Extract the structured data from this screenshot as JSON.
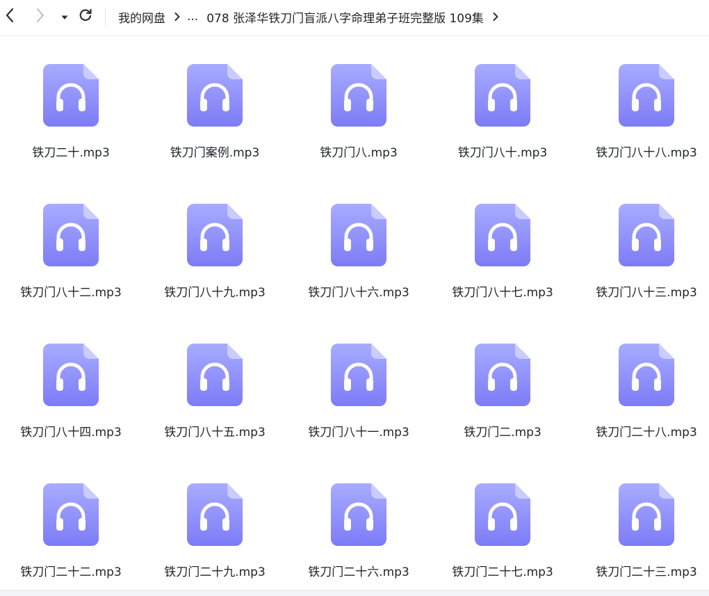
{
  "toolbar": {
    "back_icon": "chevron-left-icon",
    "forward_icon": "chevron-right-icon",
    "history_icon": "caret-down-icon",
    "refresh_icon": "refresh-icon"
  },
  "breadcrumb": {
    "root": "我的网盘",
    "ellipsis": "...",
    "current": "078 张泽华铁刀门盲派八字命理弟子班完整版 109集"
  },
  "colors": {
    "file_icon_top": "#a8acff",
    "file_icon_bottom": "#7d7bf7",
    "file_icon_fold": "#c9ccff",
    "headphone": "#ffffff"
  },
  "files": [
    {
      "name": "铁刀二十.mp3",
      "icon": "audio-file-icon"
    },
    {
      "name": "铁刀门案例.mp3",
      "icon": "audio-file-icon"
    },
    {
      "name": "铁刀门八.mp3",
      "icon": "audio-file-icon"
    },
    {
      "name": "铁刀门八十.mp3",
      "icon": "audio-file-icon"
    },
    {
      "name": "铁刀门八十八.mp3",
      "icon": "audio-file-icon"
    },
    {
      "name": "铁刀门八十二.mp3",
      "icon": "audio-file-icon"
    },
    {
      "name": "铁刀门八十九.mp3",
      "icon": "audio-file-icon"
    },
    {
      "name": "铁刀门八十六.mp3",
      "icon": "audio-file-icon"
    },
    {
      "name": "铁刀门八十七.mp3",
      "icon": "audio-file-icon"
    },
    {
      "name": "铁刀门八十三.mp3",
      "icon": "audio-file-icon"
    },
    {
      "name": "铁刀门八十四.mp3",
      "icon": "audio-file-icon"
    },
    {
      "name": "铁刀门八十五.mp3",
      "icon": "audio-file-icon"
    },
    {
      "name": "铁刀门八十一.mp3",
      "icon": "audio-file-icon"
    },
    {
      "name": "铁刀门二.mp3",
      "icon": "audio-file-icon"
    },
    {
      "name": "铁刀门二十八.mp3",
      "icon": "audio-file-icon"
    },
    {
      "name": "铁刀门二十二.mp3",
      "icon": "audio-file-icon"
    },
    {
      "name": "铁刀门二十九.mp3",
      "icon": "audio-file-icon"
    },
    {
      "name": "铁刀门二十六.mp3",
      "icon": "audio-file-icon"
    },
    {
      "name": "铁刀门二十七.mp3",
      "icon": "audio-file-icon"
    },
    {
      "name": "铁刀门二十三.mp3",
      "icon": "audio-file-icon"
    }
  ]
}
